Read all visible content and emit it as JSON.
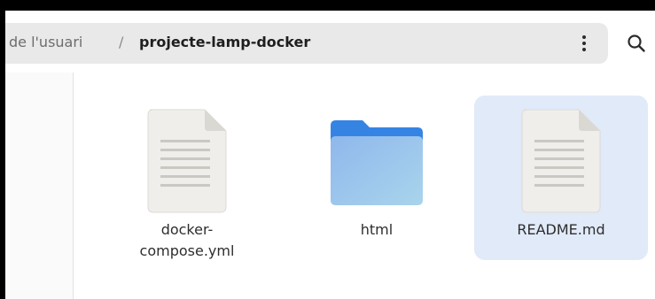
{
  "pathbar": {
    "parent": "de l'usuari",
    "separator": "/",
    "current": "projecte-lamp-docker"
  },
  "icons": {
    "menu": "vertical-dots-icon",
    "search": "search-icon",
    "file": "text-file-icon",
    "folder": "folder-icon"
  },
  "colors": {
    "selection": "#e1eaf9",
    "folder": "#3584e4"
  },
  "files": [
    {
      "label_line1": "docker-",
      "label_line2": "compose.yml",
      "type": "file"
    },
    {
      "label_line1": "html",
      "type": "folder"
    },
    {
      "label_line1": "README.md",
      "type": "file",
      "selected": true
    }
  ]
}
